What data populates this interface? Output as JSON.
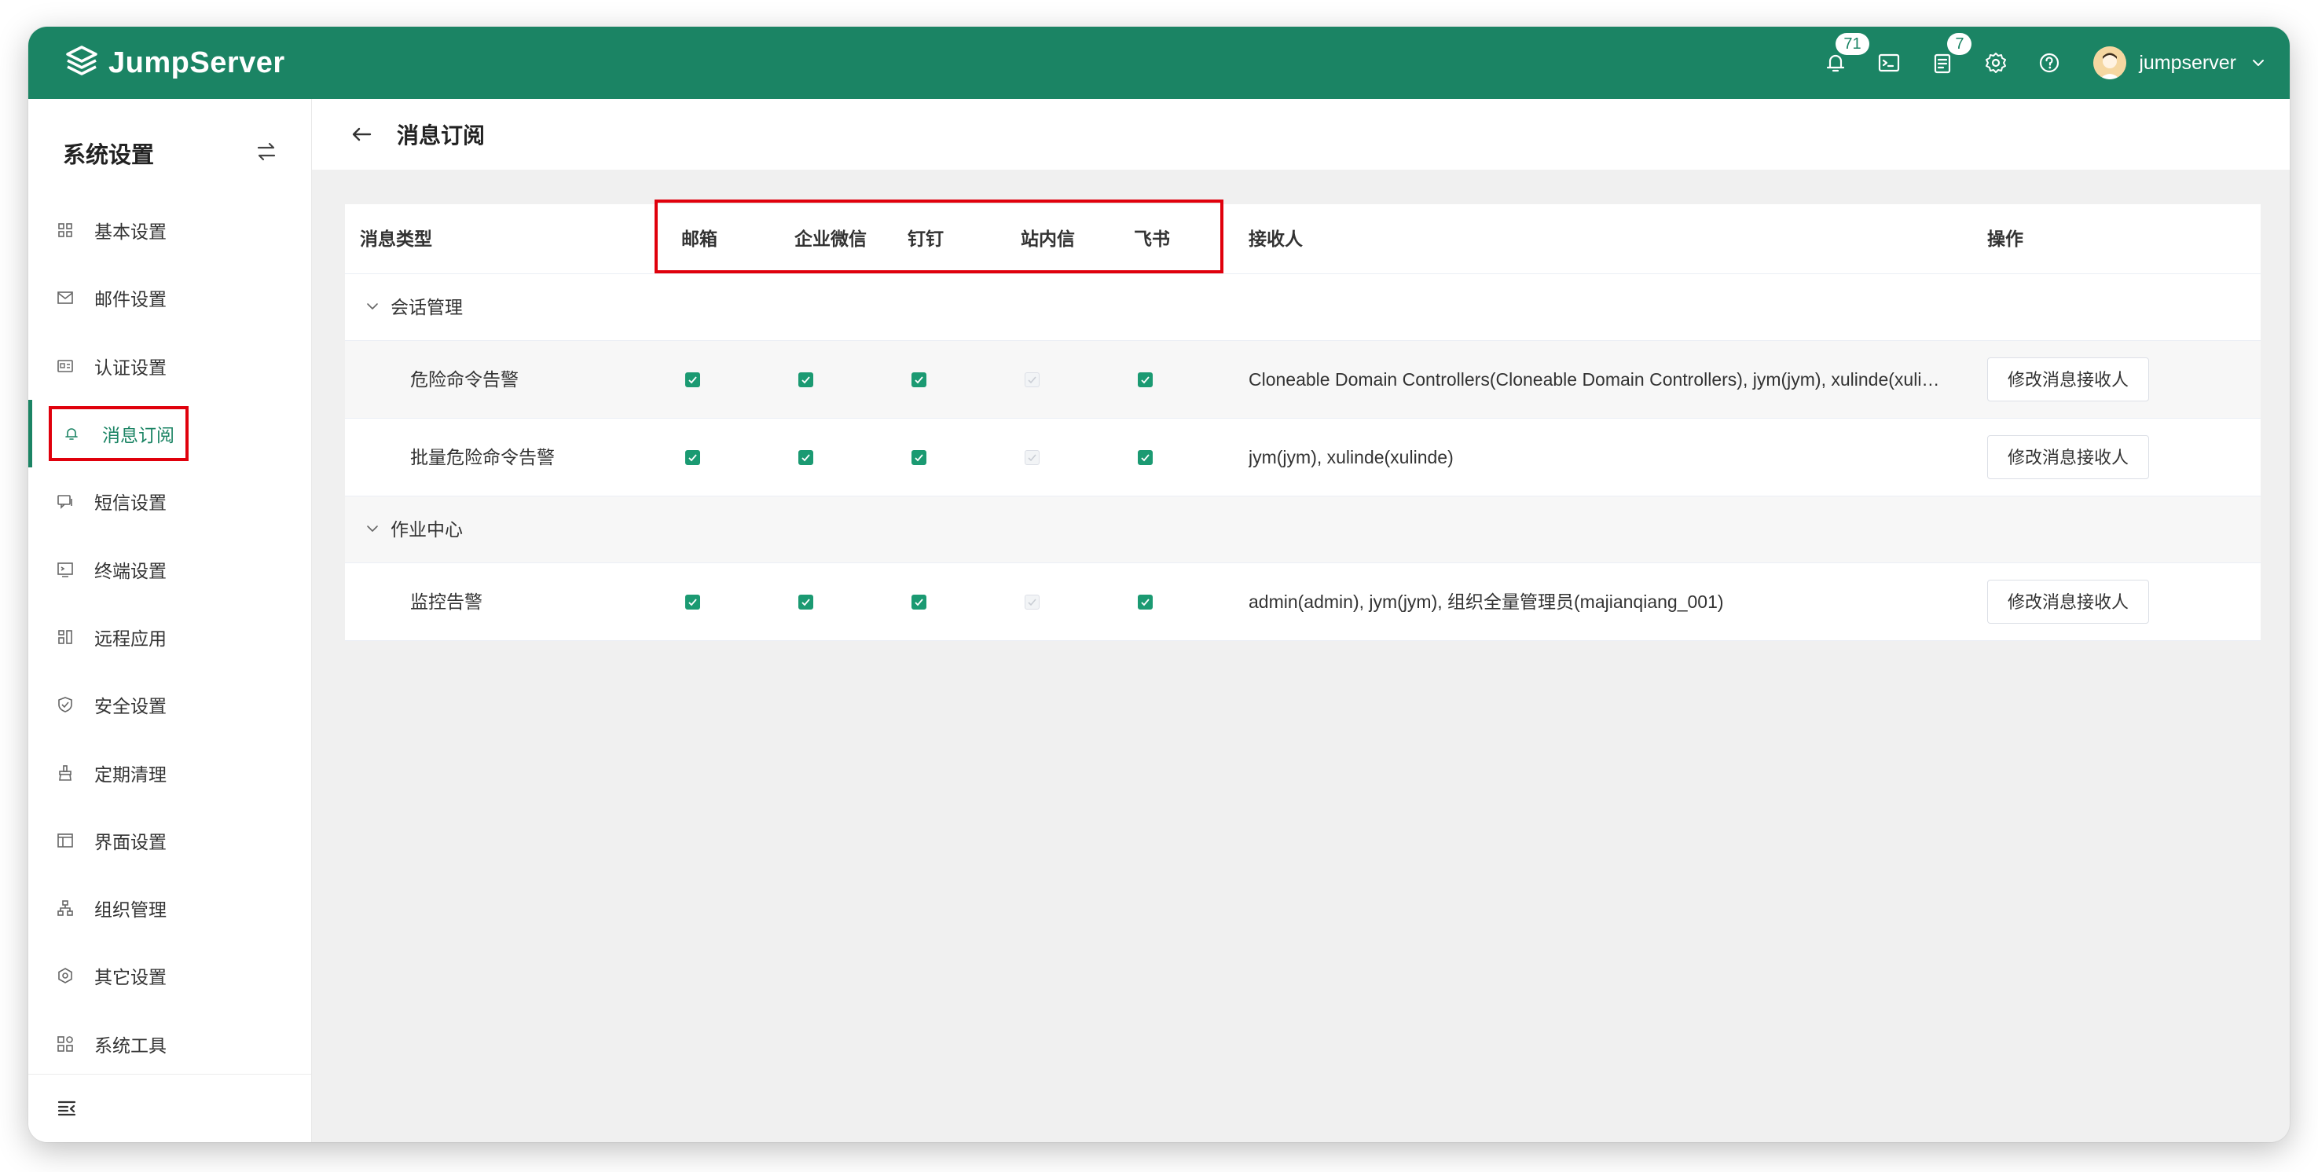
{
  "app": {
    "logo_text": "JumpServer",
    "notifications_badge": "71",
    "tasks_badge": "7",
    "user_name": "jumpserver"
  },
  "sidebar": {
    "title": "系统设置",
    "items": [
      {
        "label": "基本设置",
        "icon": "grid-icon"
      },
      {
        "label": "邮件设置",
        "icon": "mail-icon"
      },
      {
        "label": "认证设置",
        "icon": "id-card-icon"
      },
      {
        "label": "消息订阅",
        "icon": "bell-icon",
        "active": true
      },
      {
        "label": "短信设置",
        "icon": "sms-icon"
      },
      {
        "label": "终端设置",
        "icon": "terminal-icon"
      },
      {
        "label": "远程应用",
        "icon": "apps-icon"
      },
      {
        "label": "安全设置",
        "icon": "shield-icon"
      },
      {
        "label": "定期清理",
        "icon": "broom-icon"
      },
      {
        "label": "界面设置",
        "icon": "layout-icon"
      },
      {
        "label": "组织管理",
        "icon": "org-icon"
      },
      {
        "label": "其它设置",
        "icon": "hexagon-gear-icon"
      },
      {
        "label": "系统工具",
        "icon": "tools-icon"
      }
    ]
  },
  "page": {
    "title": "消息订阅"
  },
  "table": {
    "headers": {
      "type": "消息类型",
      "email": "邮箱",
      "wecom": "企业微信",
      "dingtalk": "钉钉",
      "site_msg": "站内信",
      "feishu": "飞书",
      "receivers": "接收人",
      "actions": "操作"
    },
    "groups": [
      {
        "label": "会话管理",
        "rows": [
          {
            "name": "危险命令告警",
            "checks": [
              true,
              true,
              true,
              "disabled",
              true
            ],
            "receivers": "Cloneable Domain Controllers(Cloneable Domain Controllers), jym(jym), xulinde(xuli…",
            "action": "修改消息接收人"
          },
          {
            "name": "批量危险命令告警",
            "checks": [
              true,
              true,
              true,
              "disabled",
              true
            ],
            "receivers": "jym(jym), xulinde(xulinde)",
            "action": "修改消息接收人"
          }
        ]
      },
      {
        "label": "作业中心",
        "rows": [
          {
            "name": "监控告警",
            "checks": [
              true,
              true,
              true,
              "disabled",
              true
            ],
            "receivers": "admin(admin), jym(jym), 组织全量管理员(majianqiang_001)",
            "action": "修改消息接收人"
          }
        ]
      }
    ]
  },
  "colors": {
    "brand": "#1b8464",
    "checkbox": "#1b9a72",
    "highlight": "#e0000c"
  }
}
